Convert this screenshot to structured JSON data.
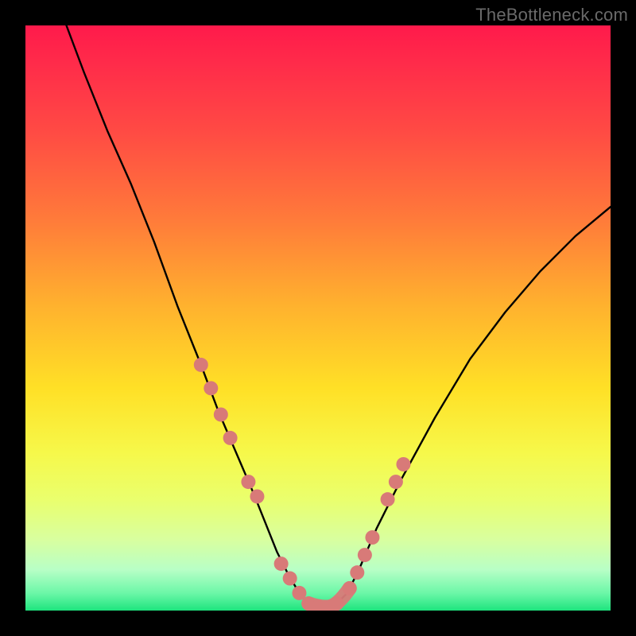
{
  "watermark": "TheBottleneck.com",
  "colors": {
    "curve_stroke": "#000000",
    "dot_fill": "#d87a78",
    "frame": "#000000"
  },
  "chart_data": {
    "type": "line",
    "title": "",
    "xlabel": "",
    "ylabel": "",
    "xlim": [
      0,
      100
    ],
    "ylim": [
      0,
      100
    ],
    "series": [
      {
        "name": "bottleneck-curve",
        "x": [
          7,
          10,
          14,
          18,
          22,
          26,
          30,
          33,
          36,
          39,
          41,
          43,
          45,
          46.8,
          48.4,
          50,
          51.6,
          53.2,
          55,
          57,
          60,
          64,
          70,
          76,
          82,
          88,
          94,
          100
        ],
        "y": [
          100,
          92,
          82,
          73,
          63,
          52,
          42,
          34,
          27,
          20,
          15,
          10,
          6,
          3,
          1.2,
          0.6,
          0.6,
          1.2,
          3,
          7,
          14,
          22,
          33,
          43,
          51,
          58,
          64,
          69
        ]
      }
    ],
    "dots": {
      "left_branch_x": [
        30,
        31.7,
        33.4,
        35.0,
        38.1,
        39.6,
        43.7,
        45.2,
        46.8,
        48.4
      ],
      "left_branch_y": [
        42,
        38,
        33.5,
        29.5,
        22,
        19.5,
        8,
        5.5,
        3,
        1.2
      ],
      "bottom_x": [
        50.0,
        51.6,
        53.2
      ],
      "bottom_y": [
        0.6,
        0.6,
        1.2
      ],
      "right_branch_x": [
        55.4,
        56.7,
        58.0,
        59.3,
        61.9,
        63.3,
        64.6
      ],
      "right_branch_y": [
        3.8,
        6.5,
        9.5,
        12.5,
        19,
        22,
        25
      ]
    }
  }
}
